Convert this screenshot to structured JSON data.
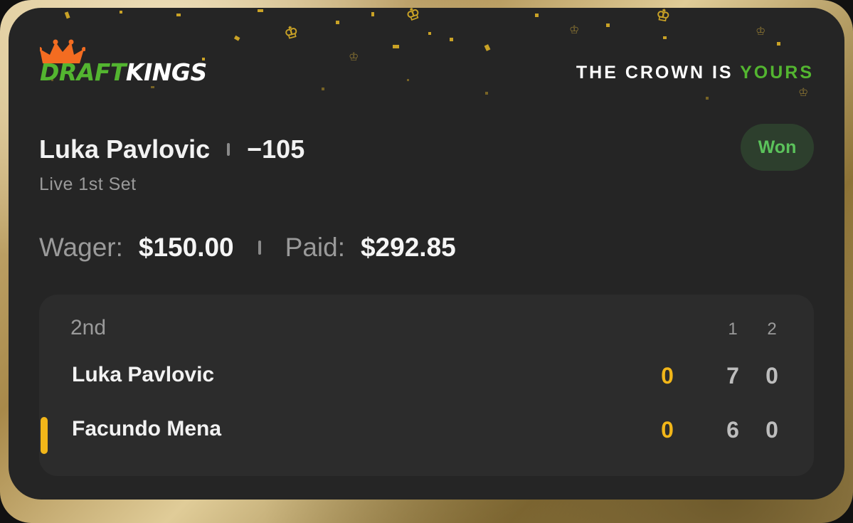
{
  "brand": {
    "logo_part1": "DRAFT",
    "logo_part2": "KINGS",
    "tagline_prefix": "THE CROWN IS ",
    "tagline_accent": "YOURS"
  },
  "bet": {
    "selection": "Luka Pavlovic",
    "odds": "−105",
    "market": "Live 1st Set",
    "status": "Won",
    "wager_label": "Wager:",
    "wager_value": "$150.00",
    "paid_label": "Paid:",
    "paid_value": "$292.85"
  },
  "scoreboard": {
    "period": "2nd",
    "set_headers": [
      "1",
      "2"
    ],
    "players": [
      {
        "name": "Luka Pavlovic",
        "game": "0",
        "sets": [
          "7",
          "0"
        ],
        "serving": false
      },
      {
        "name": "Facundo Mena",
        "game": "0",
        "sets": [
          "6",
          "0"
        ],
        "serving": true
      }
    ]
  },
  "colors": {
    "brand_green": "#53b530",
    "won_green": "#5bc25b",
    "serve_yellow": "#f2b619",
    "card_bg": "#252525",
    "panel_bg": "#2c2c2c",
    "gold_frame": "#c9ad6b"
  }
}
